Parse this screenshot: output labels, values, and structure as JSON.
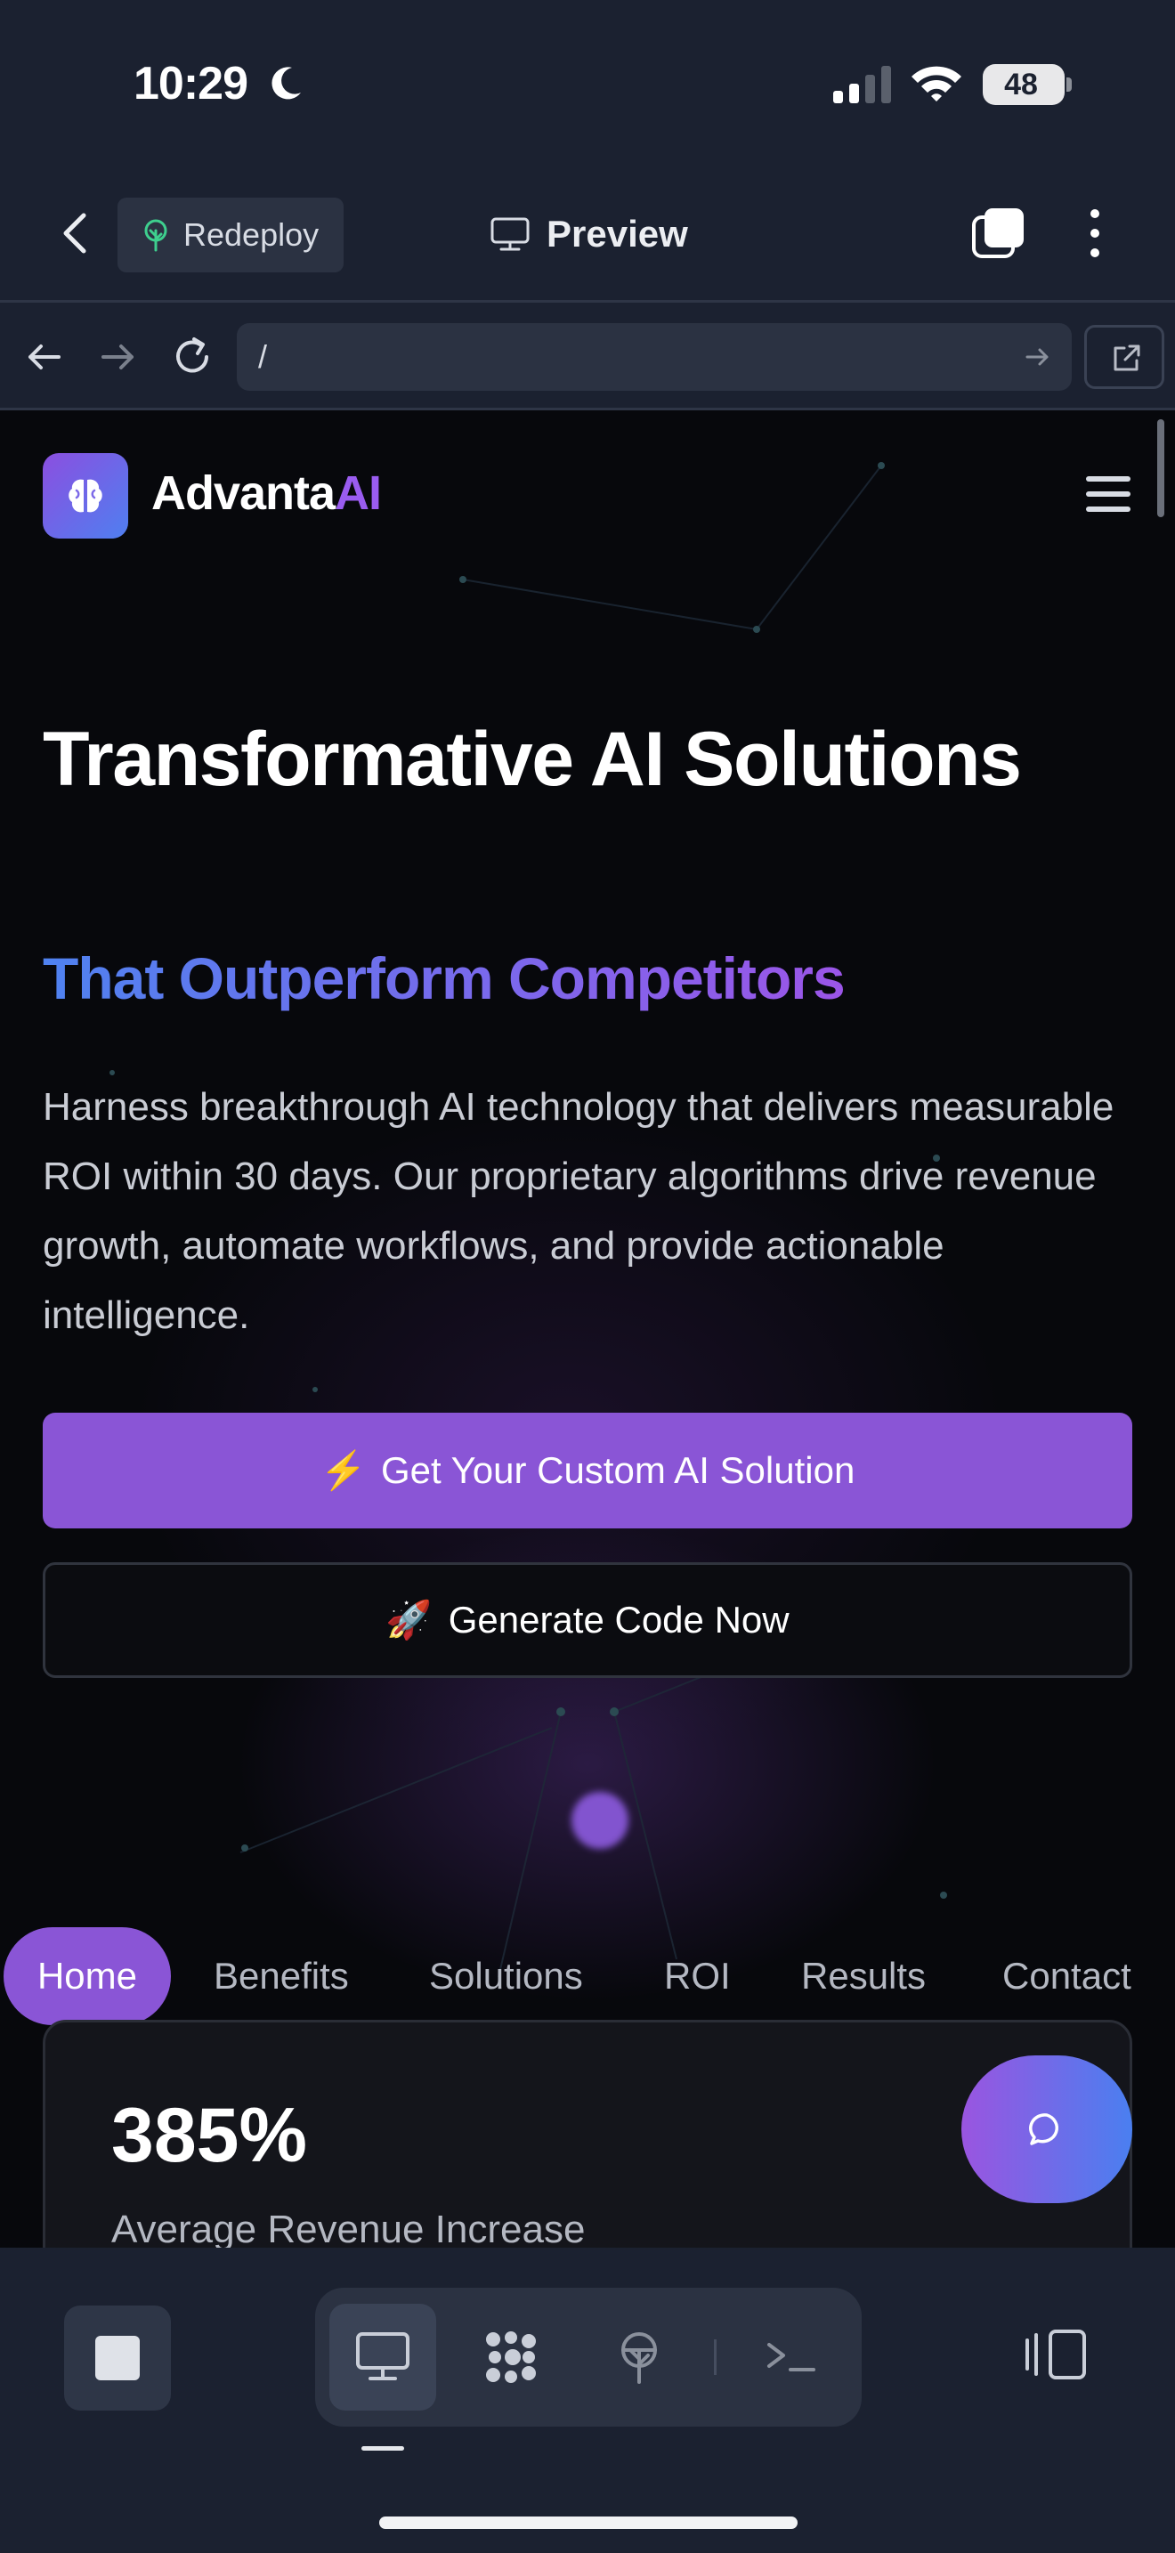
{
  "status_bar": {
    "time": "10:29",
    "battery": "48"
  },
  "app_header": {
    "redeploy_label": "Redeploy",
    "preview_label": "Preview"
  },
  "browser": {
    "url": "/"
  },
  "site": {
    "brand_main": "Advanta",
    "brand_accent": "AI",
    "hero_title": "Transformative AI Solutions",
    "hero_subtitle": "That Outperform Competitors",
    "hero_description": "Harness breakthrough AI technology that delivers measurable ROI within 30 days. Our proprietary algorithms drive revenue growth, automate workflows, and provide actionable intelligence.",
    "cta_primary": {
      "icon": "⚡",
      "label": "Get Your Custom AI Solution"
    },
    "cta_secondary": {
      "icon": "🚀",
      "label": "Generate Code Now"
    },
    "section_tabs": [
      "Home",
      "Benefits",
      "Solutions",
      "ROI",
      "Results",
      "Contact"
    ],
    "stat": {
      "value": "385%",
      "label": "Average Revenue Increase"
    }
  },
  "colors": {
    "page_bg": "#07080c",
    "chrome_bg": "#1b2130",
    "accent_purple": "#8a55d6",
    "accent_blue": "#4f82f0"
  },
  "icons": {
    "back": "chevron-left-icon",
    "redeploy": "tree-icon",
    "preview": "monitor-icon",
    "tabs": "tabs-icon",
    "more": "more-vertical-icon",
    "chat": "chat-bubble-icon",
    "logo": "brain-icon"
  }
}
